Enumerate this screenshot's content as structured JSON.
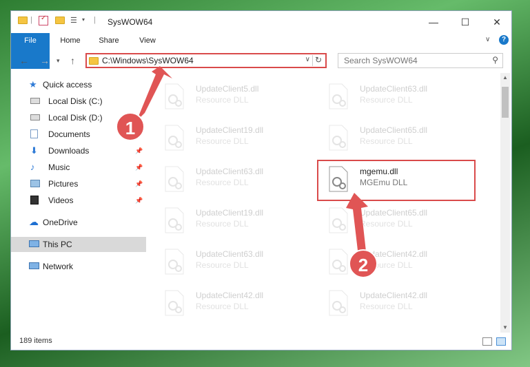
{
  "window": {
    "title": "SysWOW64",
    "controls": {
      "minimize": "—",
      "maximize": "☐",
      "close": "✕"
    }
  },
  "ribbon": {
    "tabs": [
      {
        "label": "File"
      },
      {
        "label": "Home"
      },
      {
        "label": "Share"
      },
      {
        "label": "View"
      }
    ],
    "help": "?"
  },
  "address": {
    "path": "C:\\Windows\\SysWOW64",
    "search_placeholder": "Search SysWOW64"
  },
  "sidebar": {
    "items": [
      {
        "label": "Quick access",
        "icon": "star-icon"
      },
      {
        "label": "Local Disk (C:)",
        "icon": "drive-icon"
      },
      {
        "label": "Local Disk (D:)",
        "icon": "drive-icon"
      },
      {
        "label": "Documents",
        "icon": "documents-icon"
      },
      {
        "label": "Downloads",
        "icon": "downloads-icon",
        "pinned": true
      },
      {
        "label": "Music",
        "icon": "music-icon",
        "pinned": true
      },
      {
        "label": "Pictures",
        "icon": "pictures-icon",
        "pinned": true
      },
      {
        "label": "Videos",
        "icon": "videos-icon",
        "pinned": true
      },
      {
        "label": "OneDrive",
        "icon": "cloud-icon"
      },
      {
        "label": "This PC",
        "icon": "computer-icon",
        "selected": true
      },
      {
        "label": "Network",
        "icon": "network-icon"
      }
    ]
  },
  "files": {
    "left": [
      {
        "name": "UpdateClient5.dll",
        "type": "Resource DLL"
      },
      {
        "name": "UpdateClient19.dll",
        "type": "Resource DLL"
      },
      {
        "name": "UpdateClient63.dll",
        "type": "Resource DLL"
      },
      {
        "name": "UpdateClient19.dll",
        "type": "Resource DLL"
      },
      {
        "name": "UpdateClient63.dll",
        "type": "Resource DLL"
      },
      {
        "name": "UpdateClient42.dll",
        "type": "Resource DLL"
      }
    ],
    "right": [
      {
        "name": "UpdateClient63.dll",
        "type": "Resource DLL"
      },
      {
        "name": "UpdateClient65.dll",
        "type": "Resource DLL"
      },
      {
        "name": "mgemu.dll",
        "type": "MGEmu DLL",
        "highlighted": true
      },
      {
        "name": "UpdateClient65.dll",
        "type": "Resource DLL"
      },
      {
        "name": "UpdateClient42.dll",
        "type": "Resource DLL"
      },
      {
        "name": "UpdateClient42.dll",
        "type": "Resource DLL"
      }
    ]
  },
  "status": {
    "item_count": "189 items"
  },
  "callouts": {
    "one": "1",
    "two": "2"
  },
  "colors": {
    "accent": "#1979ca",
    "highlight": "#d94a4a",
    "folder": "#f5c542"
  }
}
